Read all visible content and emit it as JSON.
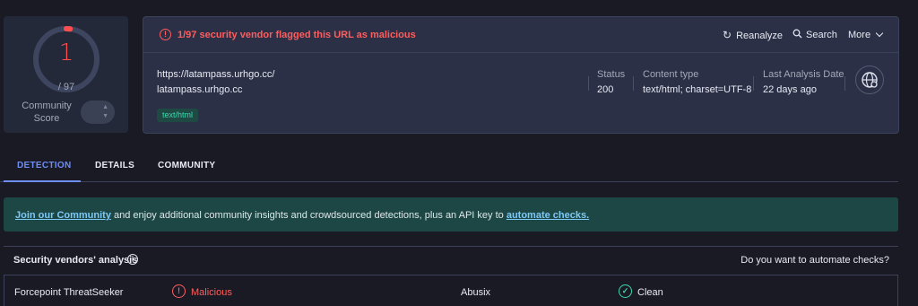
{
  "score": {
    "positives": "1",
    "total": "/ 97",
    "community_label": "Community Score",
    "gauge_fraction": 0.0103,
    "colors": {
      "malicious": "#ff4e4e",
      "ring": "#3e465f"
    }
  },
  "summary": {
    "alert_icon": "alert-circle-icon",
    "alert_text": "1/97 security vendor flagged this URL as malicious",
    "actions": [
      {
        "label": "Reanalyze",
        "icon": "refresh-icon"
      },
      {
        "label": "Search",
        "icon": "search-icon"
      },
      {
        "label": "More",
        "icon": "chevron-down-icon"
      }
    ],
    "url": "https://latampass.urhgo.cc/",
    "host": "latampass.urhgo.cc",
    "tag": "text/html",
    "fields": [
      {
        "label": "Status",
        "value": "200"
      },
      {
        "label": "Content type",
        "value": "text/html; charset=UTF-8"
      },
      {
        "label": "Last Analysis Date",
        "value": "22 days ago"
      }
    ],
    "globe_icon": "globe-icon"
  },
  "tabs": [
    {
      "label": "DETECTION",
      "active": true
    },
    {
      "label": "DETAILS",
      "active": false
    },
    {
      "label": "COMMUNITY",
      "active": false
    }
  ],
  "banner": {
    "link1": "Join our Community",
    "text": " and enjoy additional community insights and crowdsourced detections, plus an API key to ",
    "link2": "automate checks."
  },
  "vendors": {
    "title": "Security vendors' analysis",
    "automate_question": "Do you want to automate checks?",
    "rows": [
      [
        {
          "vendor": "Forcepoint ThreatSeeker",
          "verdict": "Malicious",
          "status": "malicious"
        },
        {
          "vendor": "Abusix",
          "verdict": "Clean",
          "status": "clean"
        }
      ]
    ]
  },
  "colors": {
    "background": "#1a1a24",
    "panel": "#2b3047",
    "accent": "#6e8df5",
    "malicious": "#ff5d5d",
    "clean": "#3ad9b0",
    "banner": "#1c4744"
  }
}
